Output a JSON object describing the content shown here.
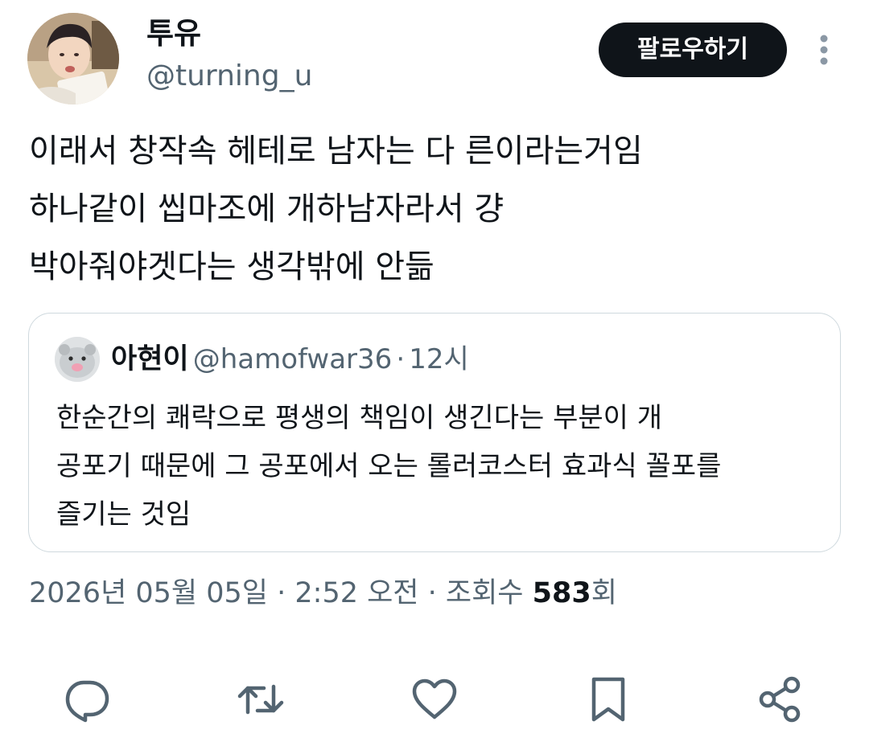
{
  "author": {
    "display_name": "투유",
    "handle": "@turning_u",
    "avatar_icon": "user-avatar-photo"
  },
  "follow_label": "팔로우하기",
  "more_icon": "more-vertical-icon",
  "tweet": {
    "lines": [
      "이래서 창작속 헤테로 남자는 다 른이라는거임",
      "하나같이 씹마조에 개하남자라서 걍",
      "박아줘야겟다는 생각밖에 안듦"
    ]
  },
  "quote": {
    "name": "아현이",
    "handle": "@hamofwar36",
    "separator": "·",
    "time": "12시",
    "lines": [
      "한순간의 쾌락으로 평생의 책임이 생긴다는 부분이 개",
      "공포기 때문에 그 공포에서 오는 롤러코스터 효과식 꼴포를",
      "즐기는 것임"
    ],
    "avatar_icon": "hamster-avatar"
  },
  "meta": {
    "date": "2026년 05월 05일",
    "sep1": " · ",
    "time": "2:52 오전",
    "sep2": " · ",
    "views_label": "조회수 ",
    "views_count": "583",
    "views_suffix": "회"
  },
  "actions": [
    "reply-icon",
    "retweet-icon",
    "like-icon",
    "bookmark-icon",
    "share-icon"
  ],
  "colors": {
    "text": "#0f1419",
    "secondary": "#536471",
    "border": "#cfd9de",
    "button_bg": "#0f1419"
  }
}
